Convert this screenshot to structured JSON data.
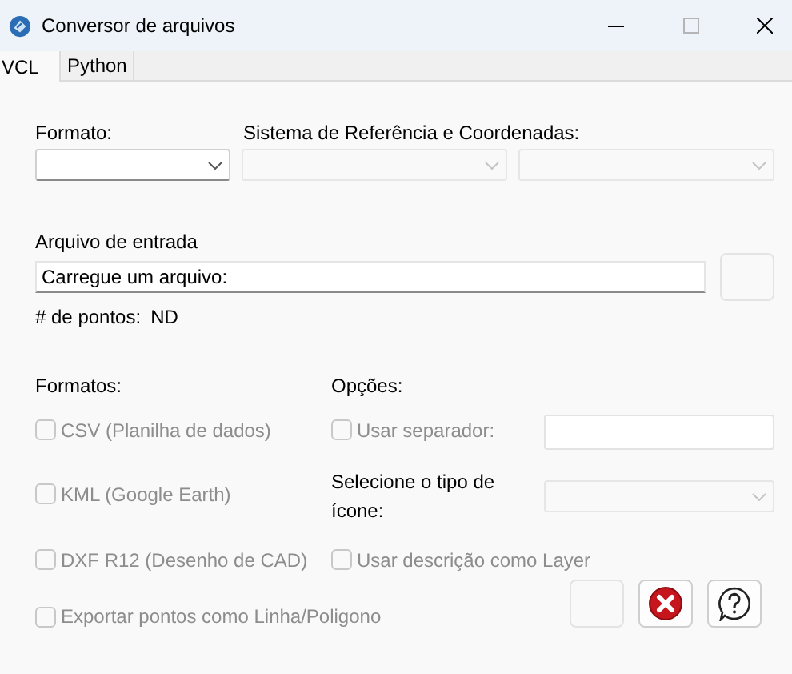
{
  "window": {
    "title": "Conversor de arquivos"
  },
  "tabs": [
    {
      "label": "VCL",
      "selected": true
    },
    {
      "label": "Python",
      "selected": false
    }
  ],
  "format": {
    "label": "Formato:",
    "disabled": false
  },
  "reference": {
    "label": "Sistema de Referência e Coordenadas:",
    "combos": [
      {
        "disabled": true
      },
      {
        "disabled": true
      }
    ]
  },
  "input_file": {
    "label": "Arquivo de entrada",
    "value": "Carregue um arquivo:"
  },
  "points": {
    "label": "# de pontos:",
    "value": "ND"
  },
  "formats": {
    "heading": "Formatos:",
    "options": [
      {
        "label": "CSV (Planilha de dados)",
        "checked": false,
        "disabled": true
      },
      {
        "label": "KML (Google Earth)",
        "checked": false,
        "disabled": true
      },
      {
        "label": "DXF R12 (Desenho de CAD)",
        "checked": false,
        "disabled": true
      },
      {
        "label": "Exportar pontos como Linha/Poligono",
        "checked": false,
        "disabled": true
      }
    ]
  },
  "options": {
    "heading": "Opções:",
    "separator": {
      "label": "Usar separador:",
      "checked": false,
      "disabled": true
    },
    "icon_type": {
      "label": "Selecione o tipo de ícone:",
      "disabled": true
    },
    "layer": {
      "label": "Usar descrição como Layer",
      "checked": false,
      "disabled": true
    }
  },
  "buttons": [
    {
      "kind": "blank",
      "disabled": true
    },
    {
      "kind": "cancel",
      "disabled": false
    },
    {
      "kind": "help",
      "disabled": false
    }
  ]
}
